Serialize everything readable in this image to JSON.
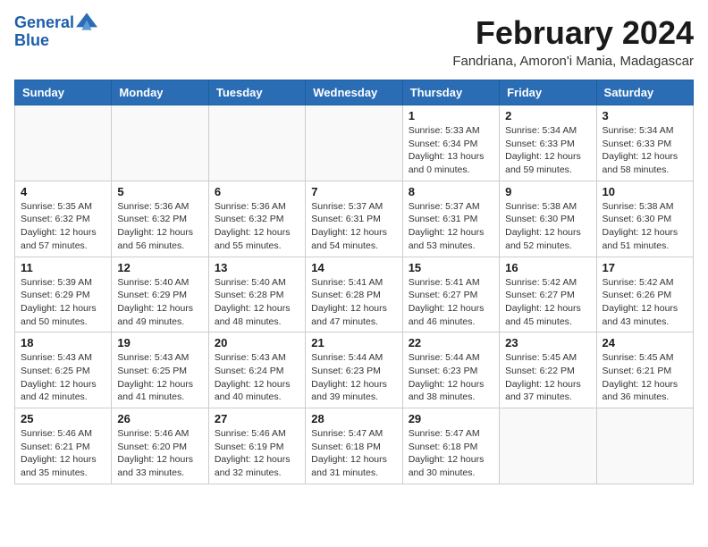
{
  "header": {
    "logo_line1": "General",
    "logo_line2": "Blue",
    "month_year": "February 2024",
    "subtitle": "Fandriana, Amoron'i Mania, Madagascar"
  },
  "calendar": {
    "days_of_week": [
      "Sunday",
      "Monday",
      "Tuesday",
      "Wednesday",
      "Thursday",
      "Friday",
      "Saturday"
    ],
    "weeks": [
      [
        {
          "day": "",
          "detail": ""
        },
        {
          "day": "",
          "detail": ""
        },
        {
          "day": "",
          "detail": ""
        },
        {
          "day": "",
          "detail": ""
        },
        {
          "day": "1",
          "detail": "Sunrise: 5:33 AM\nSunset: 6:34 PM\nDaylight: 13 hours\nand 0 minutes."
        },
        {
          "day": "2",
          "detail": "Sunrise: 5:34 AM\nSunset: 6:33 PM\nDaylight: 12 hours\nand 59 minutes."
        },
        {
          "day": "3",
          "detail": "Sunrise: 5:34 AM\nSunset: 6:33 PM\nDaylight: 12 hours\nand 58 minutes."
        }
      ],
      [
        {
          "day": "4",
          "detail": "Sunrise: 5:35 AM\nSunset: 6:32 PM\nDaylight: 12 hours\nand 57 minutes."
        },
        {
          "day": "5",
          "detail": "Sunrise: 5:36 AM\nSunset: 6:32 PM\nDaylight: 12 hours\nand 56 minutes."
        },
        {
          "day": "6",
          "detail": "Sunrise: 5:36 AM\nSunset: 6:32 PM\nDaylight: 12 hours\nand 55 minutes."
        },
        {
          "day": "7",
          "detail": "Sunrise: 5:37 AM\nSunset: 6:31 PM\nDaylight: 12 hours\nand 54 minutes."
        },
        {
          "day": "8",
          "detail": "Sunrise: 5:37 AM\nSunset: 6:31 PM\nDaylight: 12 hours\nand 53 minutes."
        },
        {
          "day": "9",
          "detail": "Sunrise: 5:38 AM\nSunset: 6:30 PM\nDaylight: 12 hours\nand 52 minutes."
        },
        {
          "day": "10",
          "detail": "Sunrise: 5:38 AM\nSunset: 6:30 PM\nDaylight: 12 hours\nand 51 minutes."
        }
      ],
      [
        {
          "day": "11",
          "detail": "Sunrise: 5:39 AM\nSunset: 6:29 PM\nDaylight: 12 hours\nand 50 minutes."
        },
        {
          "day": "12",
          "detail": "Sunrise: 5:40 AM\nSunset: 6:29 PM\nDaylight: 12 hours\nand 49 minutes."
        },
        {
          "day": "13",
          "detail": "Sunrise: 5:40 AM\nSunset: 6:28 PM\nDaylight: 12 hours\nand 48 minutes."
        },
        {
          "day": "14",
          "detail": "Sunrise: 5:41 AM\nSunset: 6:28 PM\nDaylight: 12 hours\nand 47 minutes."
        },
        {
          "day": "15",
          "detail": "Sunrise: 5:41 AM\nSunset: 6:27 PM\nDaylight: 12 hours\nand 46 minutes."
        },
        {
          "day": "16",
          "detail": "Sunrise: 5:42 AM\nSunset: 6:27 PM\nDaylight: 12 hours\nand 45 minutes."
        },
        {
          "day": "17",
          "detail": "Sunrise: 5:42 AM\nSunset: 6:26 PM\nDaylight: 12 hours\nand 43 minutes."
        }
      ],
      [
        {
          "day": "18",
          "detail": "Sunrise: 5:43 AM\nSunset: 6:25 PM\nDaylight: 12 hours\nand 42 minutes."
        },
        {
          "day": "19",
          "detail": "Sunrise: 5:43 AM\nSunset: 6:25 PM\nDaylight: 12 hours\nand 41 minutes."
        },
        {
          "day": "20",
          "detail": "Sunrise: 5:43 AM\nSunset: 6:24 PM\nDaylight: 12 hours\nand 40 minutes."
        },
        {
          "day": "21",
          "detail": "Sunrise: 5:44 AM\nSunset: 6:23 PM\nDaylight: 12 hours\nand 39 minutes."
        },
        {
          "day": "22",
          "detail": "Sunrise: 5:44 AM\nSunset: 6:23 PM\nDaylight: 12 hours\nand 38 minutes."
        },
        {
          "day": "23",
          "detail": "Sunrise: 5:45 AM\nSunset: 6:22 PM\nDaylight: 12 hours\nand 37 minutes."
        },
        {
          "day": "24",
          "detail": "Sunrise: 5:45 AM\nSunset: 6:21 PM\nDaylight: 12 hours\nand 36 minutes."
        }
      ],
      [
        {
          "day": "25",
          "detail": "Sunrise: 5:46 AM\nSunset: 6:21 PM\nDaylight: 12 hours\nand 35 minutes."
        },
        {
          "day": "26",
          "detail": "Sunrise: 5:46 AM\nSunset: 6:20 PM\nDaylight: 12 hours\nand 33 minutes."
        },
        {
          "day": "27",
          "detail": "Sunrise: 5:46 AM\nSunset: 6:19 PM\nDaylight: 12 hours\nand 32 minutes."
        },
        {
          "day": "28",
          "detail": "Sunrise: 5:47 AM\nSunset: 6:18 PM\nDaylight: 12 hours\nand 31 minutes."
        },
        {
          "day": "29",
          "detail": "Sunrise: 5:47 AM\nSunset: 6:18 PM\nDaylight: 12 hours\nand 30 minutes."
        },
        {
          "day": "",
          "detail": ""
        },
        {
          "day": "",
          "detail": ""
        }
      ]
    ]
  }
}
